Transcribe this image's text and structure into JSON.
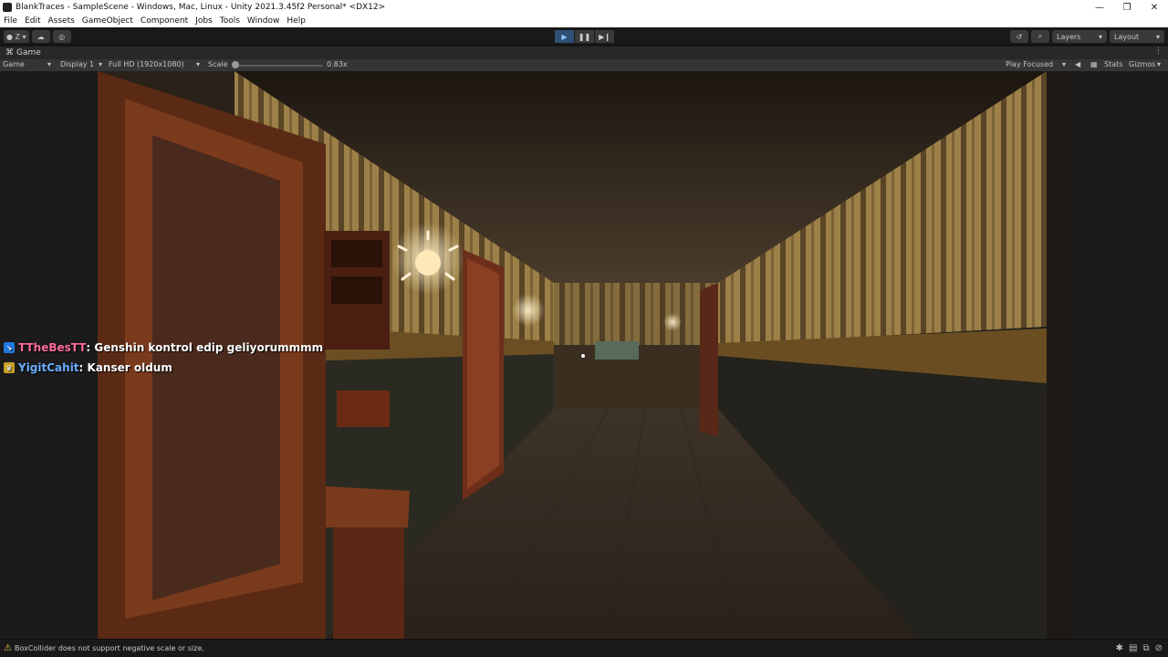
{
  "window": {
    "title": "BlankTraces - SampleScene - Windows, Mac, Linux - Unity 2021.3.45f2 Personal* <DX12>",
    "controls": [
      "—",
      "❐",
      "✕"
    ]
  },
  "menu": [
    "File",
    "Edit",
    "Assets",
    "GameObject",
    "Component",
    "Jobs",
    "Tools",
    "Window",
    "Help"
  ],
  "toolbar": {
    "account_label": "Z",
    "layers_label": "Layers",
    "layout_label": "Layout"
  },
  "game_tab": {
    "label": "Game"
  },
  "game_view": {
    "mode": "Game",
    "display": "Display 1",
    "resolution": "Full HD (1920x1080)",
    "scale_label": "Scale",
    "scale_value": "0.83x",
    "play_focused": "Play Focused",
    "stats": "Stats",
    "gizmos": "Gizmos"
  },
  "chat": [
    {
      "user": "TTheBesTT",
      "message": ": Genshin kontrol edip geliyorummmm",
      "badge_color": "#1f7adf",
      "user_color": "#ff6b9a"
    },
    {
      "user": "YigitCahit",
      "message": ": Kanser oldum",
      "badge_color": "#c9a227",
      "user_color": "#6aaeff"
    }
  ],
  "status": {
    "message": "BoxCollider does not support negative scale or size."
  },
  "colors": {
    "play_active": "#2f4f74",
    "warning": "#f2c94c"
  }
}
